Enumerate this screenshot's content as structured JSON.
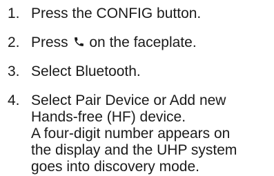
{
  "steps": [
    {
      "number": "1.",
      "lines": [
        "Press the CONFIG button."
      ]
    },
    {
      "number": "2.",
      "before_icon": "Press",
      "icon": "phone-icon",
      "after_icon": "on the faceplate."
    },
    {
      "number": "3.",
      "lines": [
        "Select Bluetooth."
      ]
    },
    {
      "number": "4.",
      "lines": [
        "Select Pair Device or Add new",
        "Hands-free (HF) device.",
        "A four-digit number appears on",
        "the display and the UHP system",
        "goes into discovery mode."
      ]
    }
  ]
}
